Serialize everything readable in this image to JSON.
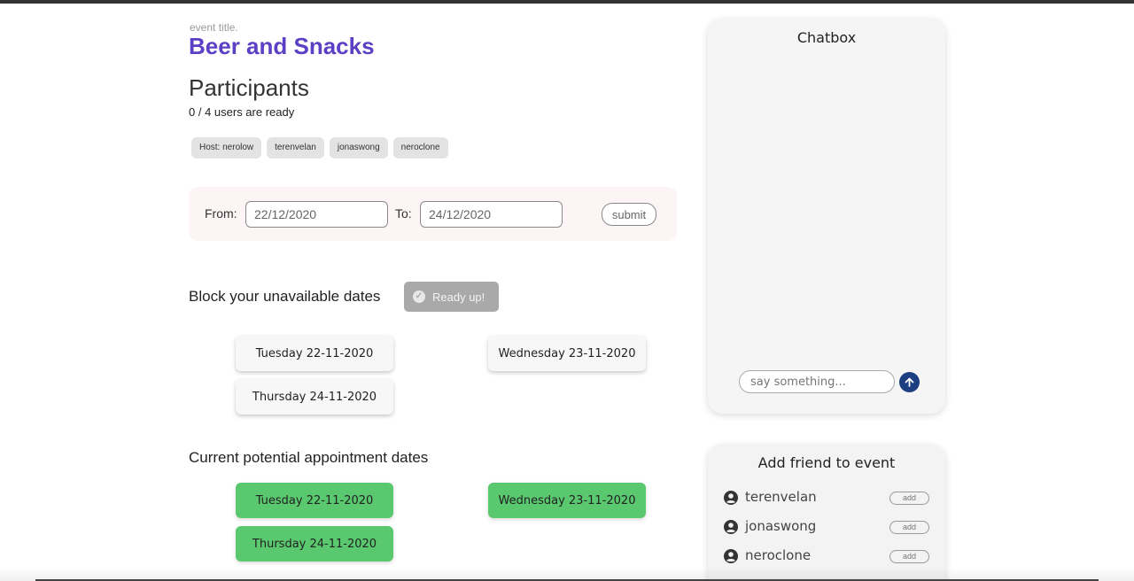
{
  "event": {
    "label": "event title.",
    "title": "Beer and Snacks"
  },
  "participants": {
    "title": "Participants",
    "ready_status": "0 / 4 users are ready",
    "chips": [
      "Host: nerolow",
      "terenvelan",
      "jonaswong",
      "neroclone"
    ]
  },
  "date_range": {
    "from_label": "From:",
    "from_value": "22/12/2020",
    "to_label": "To:",
    "to_value": "24/12/2020",
    "submit_label": "submit"
  },
  "unavailable": {
    "title": "Block your unavailable dates",
    "ready_button": "Ready up!",
    "dates": [
      "Tuesday 22-11-2020",
      "Wednesday 23-11-2020",
      "Thursday 24-11-2020"
    ]
  },
  "potential": {
    "title": "Current potential appointment dates",
    "dates": [
      "Tuesday 22-11-2020",
      "Wednesday 23-11-2020",
      "Thursday 24-11-2020"
    ],
    "color": "#5ac86e"
  },
  "chatbox": {
    "title": "Chatbox",
    "input_placeholder": "say something...",
    "send_icon": "arrow-up-icon"
  },
  "add_friend": {
    "title": "Add friend to event",
    "friends": [
      {
        "name": "terenvelan",
        "action": "add"
      },
      {
        "name": "jonaswong",
        "action": "add"
      },
      {
        "name": "neroclone",
        "action": "add"
      }
    ]
  },
  "colors": {
    "accent": "#5b3fc4",
    "send_button": "#1d3f82",
    "ready_button": "#a9a9a9"
  }
}
